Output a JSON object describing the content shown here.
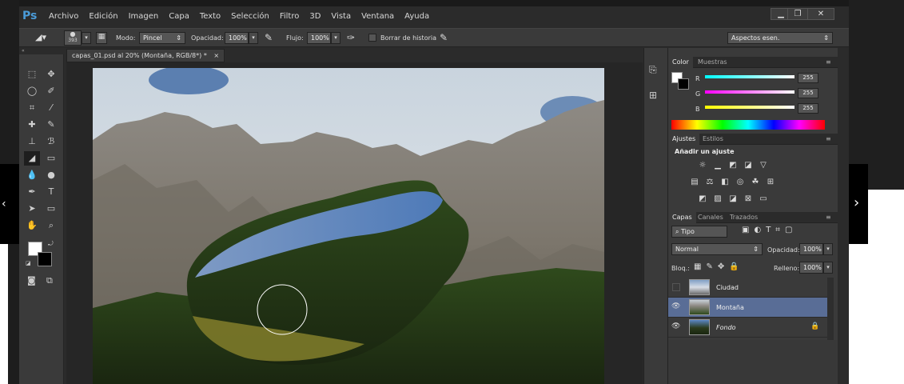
{
  "app": {
    "logo": "Ps"
  },
  "menu": [
    "Archivo",
    "Edición",
    "Imagen",
    "Capa",
    "Texto",
    "Selección",
    "Filtro",
    "3D",
    "Vista",
    "Ventana",
    "Ayuda"
  ],
  "window_buttons": {
    "minimize": "▁",
    "restore": "❐",
    "close": "✕"
  },
  "options": {
    "brush_size": "393",
    "mode_label": "Modo:",
    "mode_value": "Pincel",
    "opacity_label": "Opacidad:",
    "opacity_value": "100%",
    "flow_label": "Flujo:",
    "flow_value": "100%",
    "history_label": "Borrar de historia",
    "workspace": "Aspectos esen."
  },
  "document": {
    "tab_title": "capas_01.psd al 20% (Montaña, RGB/8*) *",
    "close": "×"
  },
  "color_panel": {
    "tabs": [
      "Color",
      "Muestras"
    ],
    "channels": [
      {
        "name": "R",
        "value": "255",
        "color": "#ff2020"
      },
      {
        "name": "G",
        "value": "255",
        "color": "#20e020"
      },
      {
        "name": "B",
        "value": "255",
        "color": "#3050ff"
      }
    ]
  },
  "adjust_panel": {
    "tabs": [
      "Ajustes",
      "Estilos"
    ],
    "heading": "Añadir un ajuste"
  },
  "layers_panel": {
    "tabs": [
      "Capas",
      "Canales",
      "Trazados"
    ],
    "filter": "Tipo",
    "blend_mode": "Normal",
    "opacity_label": "Opacidad:",
    "opacity_value": "100%",
    "lock_label": "Bloq.:",
    "fill_label": "Relleno:",
    "fill_value": "100%",
    "layers": [
      {
        "name": "Ciudad",
        "visible": false,
        "selected": false
      },
      {
        "name": "Montaña",
        "visible": true,
        "selected": true
      },
      {
        "name": "Fondo",
        "visible": true,
        "selected": false,
        "locked": true
      }
    ]
  },
  "colors": {
    "accent_selection": "#596d96",
    "app_bg": "#2b2b2b"
  }
}
